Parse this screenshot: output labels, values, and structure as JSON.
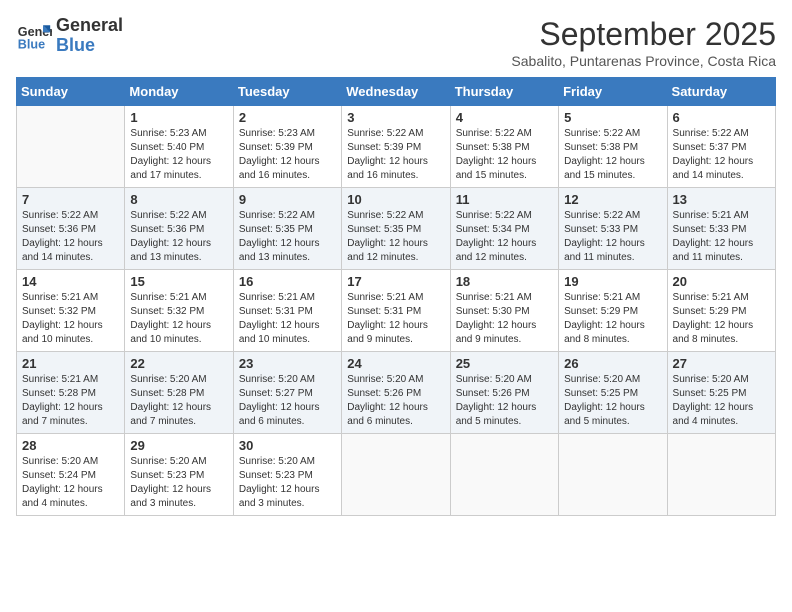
{
  "header": {
    "logo_line1": "General",
    "logo_line2": "Blue",
    "month_year": "September 2025",
    "location": "Sabalito, Puntarenas Province, Costa Rica"
  },
  "days_of_week": [
    "Sunday",
    "Monday",
    "Tuesday",
    "Wednesday",
    "Thursday",
    "Friday",
    "Saturday"
  ],
  "weeks": [
    [
      {
        "num": "",
        "info": ""
      },
      {
        "num": "1",
        "info": "Sunrise: 5:23 AM\nSunset: 5:40 PM\nDaylight: 12 hours\nand 17 minutes."
      },
      {
        "num": "2",
        "info": "Sunrise: 5:23 AM\nSunset: 5:39 PM\nDaylight: 12 hours\nand 16 minutes."
      },
      {
        "num": "3",
        "info": "Sunrise: 5:22 AM\nSunset: 5:39 PM\nDaylight: 12 hours\nand 16 minutes."
      },
      {
        "num": "4",
        "info": "Sunrise: 5:22 AM\nSunset: 5:38 PM\nDaylight: 12 hours\nand 15 minutes."
      },
      {
        "num": "5",
        "info": "Sunrise: 5:22 AM\nSunset: 5:38 PM\nDaylight: 12 hours\nand 15 minutes."
      },
      {
        "num": "6",
        "info": "Sunrise: 5:22 AM\nSunset: 5:37 PM\nDaylight: 12 hours\nand 14 minutes."
      }
    ],
    [
      {
        "num": "7",
        "info": "Sunrise: 5:22 AM\nSunset: 5:36 PM\nDaylight: 12 hours\nand 14 minutes."
      },
      {
        "num": "8",
        "info": "Sunrise: 5:22 AM\nSunset: 5:36 PM\nDaylight: 12 hours\nand 13 minutes."
      },
      {
        "num": "9",
        "info": "Sunrise: 5:22 AM\nSunset: 5:35 PM\nDaylight: 12 hours\nand 13 minutes."
      },
      {
        "num": "10",
        "info": "Sunrise: 5:22 AM\nSunset: 5:35 PM\nDaylight: 12 hours\nand 12 minutes."
      },
      {
        "num": "11",
        "info": "Sunrise: 5:22 AM\nSunset: 5:34 PM\nDaylight: 12 hours\nand 12 minutes."
      },
      {
        "num": "12",
        "info": "Sunrise: 5:22 AM\nSunset: 5:33 PM\nDaylight: 12 hours\nand 11 minutes."
      },
      {
        "num": "13",
        "info": "Sunrise: 5:21 AM\nSunset: 5:33 PM\nDaylight: 12 hours\nand 11 minutes."
      }
    ],
    [
      {
        "num": "14",
        "info": "Sunrise: 5:21 AM\nSunset: 5:32 PM\nDaylight: 12 hours\nand 10 minutes."
      },
      {
        "num": "15",
        "info": "Sunrise: 5:21 AM\nSunset: 5:32 PM\nDaylight: 12 hours\nand 10 minutes."
      },
      {
        "num": "16",
        "info": "Sunrise: 5:21 AM\nSunset: 5:31 PM\nDaylight: 12 hours\nand 10 minutes."
      },
      {
        "num": "17",
        "info": "Sunrise: 5:21 AM\nSunset: 5:31 PM\nDaylight: 12 hours\nand 9 minutes."
      },
      {
        "num": "18",
        "info": "Sunrise: 5:21 AM\nSunset: 5:30 PM\nDaylight: 12 hours\nand 9 minutes."
      },
      {
        "num": "19",
        "info": "Sunrise: 5:21 AM\nSunset: 5:29 PM\nDaylight: 12 hours\nand 8 minutes."
      },
      {
        "num": "20",
        "info": "Sunrise: 5:21 AM\nSunset: 5:29 PM\nDaylight: 12 hours\nand 8 minutes."
      }
    ],
    [
      {
        "num": "21",
        "info": "Sunrise: 5:21 AM\nSunset: 5:28 PM\nDaylight: 12 hours\nand 7 minutes."
      },
      {
        "num": "22",
        "info": "Sunrise: 5:20 AM\nSunset: 5:28 PM\nDaylight: 12 hours\nand 7 minutes."
      },
      {
        "num": "23",
        "info": "Sunrise: 5:20 AM\nSunset: 5:27 PM\nDaylight: 12 hours\nand 6 minutes."
      },
      {
        "num": "24",
        "info": "Sunrise: 5:20 AM\nSunset: 5:26 PM\nDaylight: 12 hours\nand 6 minutes."
      },
      {
        "num": "25",
        "info": "Sunrise: 5:20 AM\nSunset: 5:26 PM\nDaylight: 12 hours\nand 5 minutes."
      },
      {
        "num": "26",
        "info": "Sunrise: 5:20 AM\nSunset: 5:25 PM\nDaylight: 12 hours\nand 5 minutes."
      },
      {
        "num": "27",
        "info": "Sunrise: 5:20 AM\nSunset: 5:25 PM\nDaylight: 12 hours\nand 4 minutes."
      }
    ],
    [
      {
        "num": "28",
        "info": "Sunrise: 5:20 AM\nSunset: 5:24 PM\nDaylight: 12 hours\nand 4 minutes."
      },
      {
        "num": "29",
        "info": "Sunrise: 5:20 AM\nSunset: 5:23 PM\nDaylight: 12 hours\nand 3 minutes."
      },
      {
        "num": "30",
        "info": "Sunrise: 5:20 AM\nSunset: 5:23 PM\nDaylight: 12 hours\nand 3 minutes."
      },
      {
        "num": "",
        "info": ""
      },
      {
        "num": "",
        "info": ""
      },
      {
        "num": "",
        "info": ""
      },
      {
        "num": "",
        "info": ""
      }
    ]
  ]
}
